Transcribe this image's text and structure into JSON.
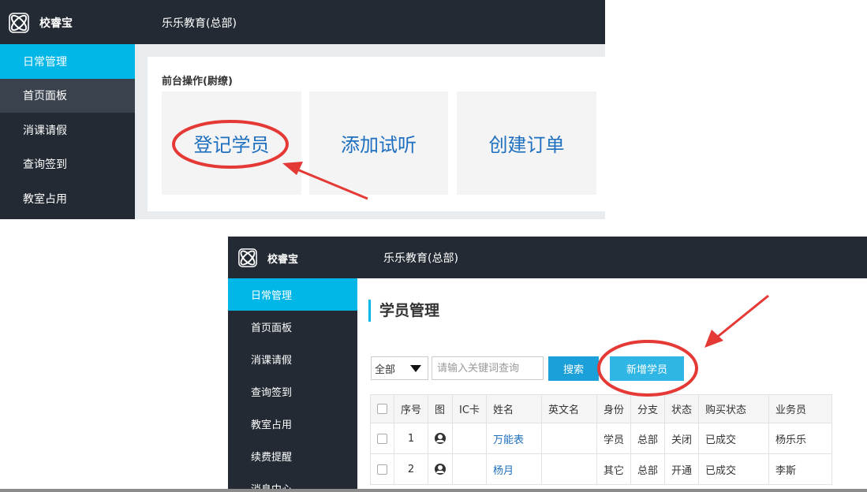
{
  "panel_top": {
    "brand": "校睿宝",
    "org": "乐乐教育(总部)",
    "sidebar": [
      "日常管理",
      "首页面板",
      "消课请假",
      "查询签到",
      "教室占用"
    ],
    "section_title": "前台操作(尉缭)",
    "tiles": [
      "登记学员",
      "添加试听",
      "创建订单"
    ]
  },
  "panel_bottom": {
    "brand": "校睿宝",
    "org": "乐乐教育(总部)",
    "sidebar": [
      "日常管理",
      "首页面板",
      "消课请假",
      "查询签到",
      "教室占用",
      "续费提醒",
      "消息中心"
    ],
    "page_title": "学员管理",
    "filter": {
      "selected": "全部",
      "placeholder": "请输入关键词查询"
    },
    "search_label": "搜索",
    "add_label": "新增学员",
    "table": {
      "headers": [
        "序号",
        "图",
        "IC卡",
        "姓名",
        "英文名",
        "身份",
        "分支",
        "状态",
        "购买状态",
        "业务员"
      ],
      "rows": [
        {
          "no": "1",
          "ic": "",
          "name": "万能表",
          "en": "",
          "role": "学员",
          "branch": "总部",
          "status": "关闭",
          "purchase": "已成交",
          "sales": "杨乐乐"
        },
        {
          "no": "2",
          "ic": "",
          "name": "杨月",
          "en": "",
          "role": "其它",
          "branch": "总部",
          "status": "开通",
          "purchase": "已成交",
          "sales": "李斯"
        }
      ]
    }
  },
  "colors": {
    "topbar": "#232a33",
    "accent": "#00b7e8",
    "link": "#1e6fbf",
    "annotation": "#e53935"
  }
}
